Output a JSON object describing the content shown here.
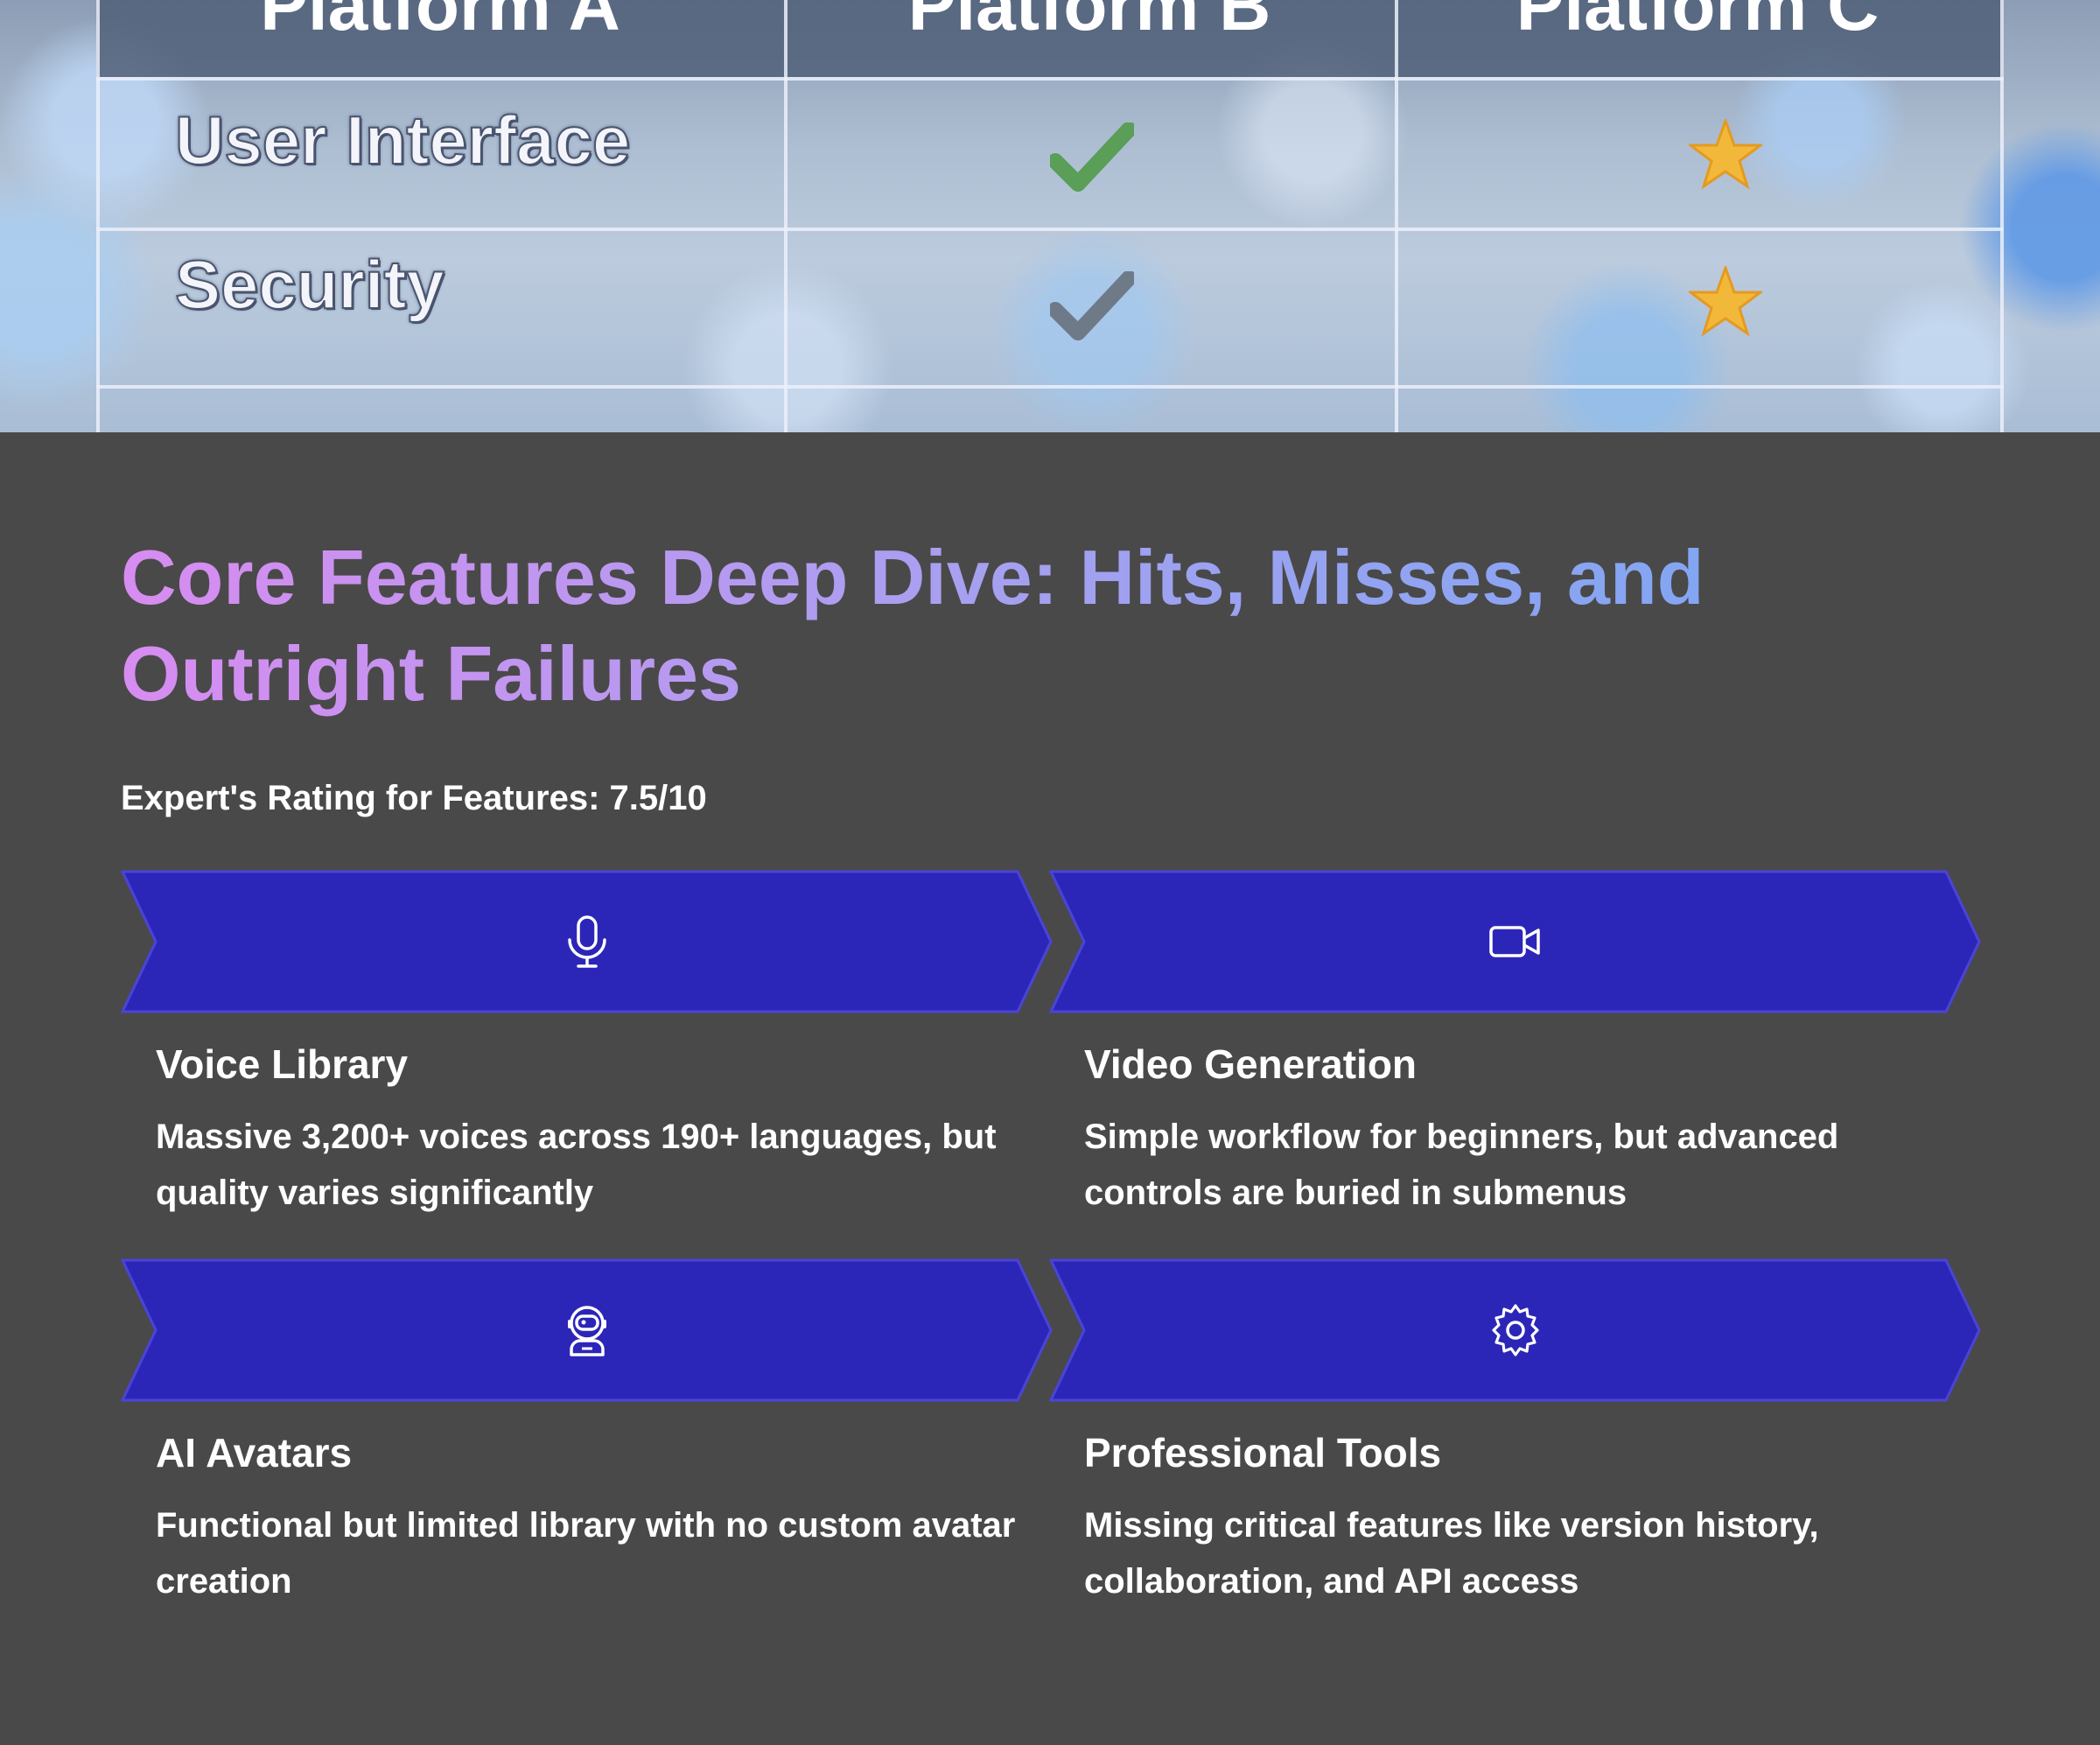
{
  "comparison_table": {
    "columns": [
      "Platform A",
      "Platform B",
      "Platform C"
    ],
    "rows": [
      {
        "label": "User Interface",
        "b": "green-checkmark-icon",
        "c": "star-icon"
      },
      {
        "label": "Security",
        "b": "gray-checkmark-icon",
        "c": "star-icon"
      }
    ]
  },
  "article": {
    "title": "Core Features Deep Dive: Hits, Misses, and Outright Failures",
    "rating": "Expert's Rating for Features: 7.5/10"
  },
  "features": [
    {
      "icon": "microphone-icon",
      "title": "Voice Library",
      "description": "Massive 3,200+ voices across 190+ languages, but quality varies significantly"
    },
    {
      "icon": "video-camera-icon",
      "title": "Video Generation",
      "description": "Simple workflow for beginners, but advanced controls are buried in submenus"
    },
    {
      "icon": "astronaut-avatar-icon",
      "title": "AI Avatars",
      "description": "Functional but limited library with no custom avatar creation"
    },
    {
      "icon": "gear-icon",
      "title": "Professional Tools",
      "description": "Missing critical features like version history, collaboration, and API access"
    }
  ],
  "colors": {
    "background": "#4a4949",
    "arrow_fill": "#2c26b8",
    "arrow_border": "#4a44d8",
    "title_gradient": [
      "#d78cf0",
      "#74a8f3"
    ],
    "check_green": "#5a9e58",
    "check_gray": "#6f7a88",
    "star": "#f2b83a"
  }
}
